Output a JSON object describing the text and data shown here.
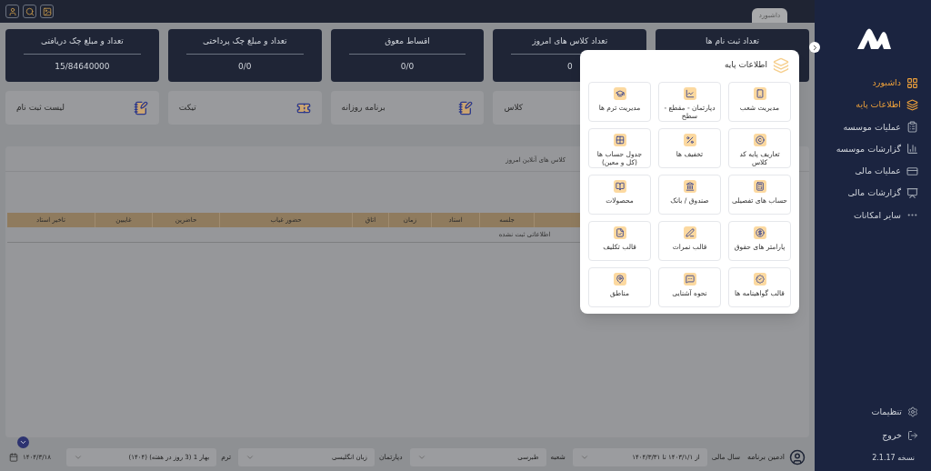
{
  "top_bar": {
    "tab": {
      "label": "داشبورد",
      "selected": true
    }
  },
  "stat_cards": [
    {
      "title": "تعداد ثبت نام ها"
    },
    {
      "title": "تعداد کلاس های امروز",
      "value": "0"
    },
    {
      "title": "اقساط معوق",
      "value": "0/0"
    },
    {
      "title": "تعداد و مبلغ چک پرداختی",
      "value": "0/0"
    },
    {
      "title": "تعداد و مبلغ چک دریافتی",
      "value": "15/84640000"
    }
  ],
  "quick_links": [
    "کلاس",
    "برنامه روزانه",
    "تیکت",
    "لیست ثبت نام"
  ],
  "panel": {
    "tabs": [
      {
        "label": "کلاس های آنلاین امروز",
        "selected": false
      }
    ],
    "table": {
      "columns": [
        "جلسه",
        "استاد",
        "زمان",
        "اتاق",
        "حضور غیاب",
        "حاضرین",
        "غایبین",
        "تاخیر استاد"
      ],
      "empty_message": "اطلاعاتی ثبت نشده"
    }
  },
  "popup": {
    "title": "اطلاعات پایه",
    "items": [
      "مدیریت شعب",
      "دپارتمان - مقطع - سطح",
      "مدیریت ترم ها",
      "تعاریف پایه کد کلاس",
      "تخفیف ها",
      "جدول حساب ها (کل و معین)",
      "حساب های تفصیلی",
      "صندوق / بانک",
      "محصولات",
      "پارامتر های حقوق",
      "قالب نمرات",
      "قالب تکلیف",
      "قالب گواهینامه ها",
      "نحوه آشنایی",
      "مناطق"
    ]
  },
  "sidebar": {
    "items": [
      {
        "label": "داشبورد",
        "selected": true
      },
      {
        "label": "اطلاعات پایه",
        "selected": true
      },
      {
        "label": "عملیات موسسه",
        "selected": false
      },
      {
        "label": "گزارشات موسسه",
        "selected": false
      },
      {
        "label": "عملیات مالی",
        "selected": false
      },
      {
        "label": "گزارشات مالی",
        "selected": false
      },
      {
        "label": "سایر امکانات",
        "selected": false
      }
    ],
    "footer": [
      "تنظیمات",
      "خروج"
    ],
    "version": "نسخه 2.1.17"
  },
  "bottom_bar": {
    "user": "ادمین برنامه",
    "fields": [
      {
        "label": "سال مالی",
        "value": "از ۱۴۰۳/۱/۱ تا ۱۴۰۴/۳/۳۱"
      },
      {
        "label": "شعبه",
        "value": "طبرسی"
      },
      {
        "label": "دپارتمان",
        "value": "زبان انگلیسی"
      },
      {
        "label": "ترم",
        "value": "بهار 1 (3 روز در هفته) (۱۴۰۴)"
      }
    ],
    "date": "۱۴۰۴/۳/۱۸"
  }
}
